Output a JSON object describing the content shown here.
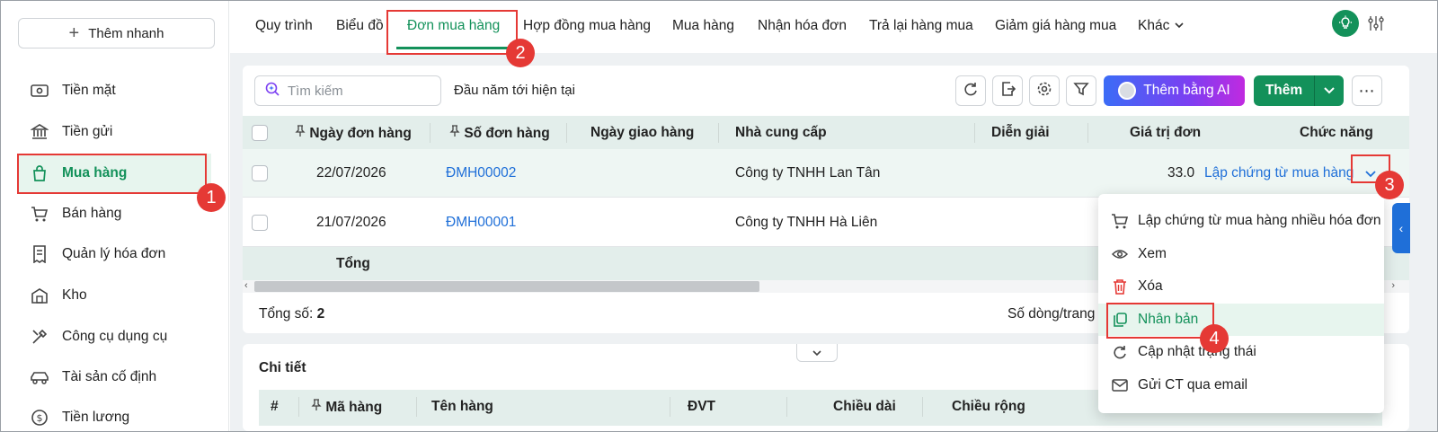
{
  "sidebar": {
    "quick_add": "Thêm nhanh",
    "items": [
      {
        "label": "Tiền mặt",
        "icon": "cash-icon"
      },
      {
        "label": "Tiền gửi",
        "icon": "bank-icon"
      },
      {
        "label": "Mua hàng",
        "icon": "shopping-bag-icon",
        "active": true
      },
      {
        "label": "Bán hàng",
        "icon": "cart-icon"
      },
      {
        "label": "Quản lý hóa đơn",
        "icon": "receipt-icon"
      },
      {
        "label": "Kho",
        "icon": "warehouse-icon"
      },
      {
        "label": "Công cụ dụng cụ",
        "icon": "tools-icon"
      },
      {
        "label": "Tài sản cố định",
        "icon": "car-icon"
      },
      {
        "label": "Tiền lương",
        "icon": "salary-icon"
      }
    ]
  },
  "tabs": [
    "Quy trình",
    "Biểu đồ",
    "Đơn mua hàng",
    "Hợp đồng mua hàng",
    "Mua hàng",
    "Nhận hóa đơn",
    "Trả lại hàng mua",
    "Giảm giá hàng mua",
    "Khác"
  ],
  "active_tab": "Đơn mua hàng",
  "toolbar": {
    "search_placeholder": "Tìm kiếm",
    "period": "Đầu năm tới hiện tại",
    "ai_button": "Thêm bằng AI",
    "add_button": "Thêm"
  },
  "table": {
    "columns": [
      "Ngày đơn hàng",
      "Số đơn hàng",
      "Ngày giao hàng",
      "Nhà cung cấp",
      "Diễn giải",
      "Giá trị đơn",
      "Chức năng"
    ],
    "rows": [
      {
        "date": "22/07/2026",
        "number": "ĐMH00002",
        "delivery": "",
        "supplier": "Công ty TNHH Lan Tân",
        "note": "",
        "value": "33.0",
        "action": "Lập chứng từ mua hàng"
      },
      {
        "date": "21/07/2026",
        "number": "ĐMH00001",
        "delivery": "",
        "supplier": "Công ty TNHH Hà Liên",
        "note": "",
        "value": "",
        "action": ""
      }
    ],
    "total_label": "Tổng",
    "count_label": "Tổng số:",
    "count_value": "2",
    "rows_per_page_label": "Số dòng/trang"
  },
  "menu": {
    "items": [
      {
        "label": "Lập chứng từ mua hàng nhiều hóa đơn",
        "icon": "cart-icon"
      },
      {
        "label": "Xem",
        "icon": "eye-icon"
      },
      {
        "label": "Xóa",
        "icon": "trash-icon"
      },
      {
        "label": "Nhân bản",
        "icon": "copy-icon",
        "hover": true
      },
      {
        "label": "Cập nhật trạng thái",
        "icon": "refresh-icon"
      },
      {
        "label": "Gửi CT qua email",
        "icon": "mail-icon"
      }
    ]
  },
  "detail": {
    "title": "Chi tiết",
    "columns": [
      "#",
      "Mã hàng",
      "Tên hàng",
      "ĐVT",
      "Chiều dài",
      "Chiều rộng"
    ]
  },
  "annotations": [
    "1",
    "2",
    "3",
    "4"
  ],
  "colors": {
    "accent": "#13915a",
    "highlight": "#e53935",
    "link": "#1f6fd8"
  }
}
